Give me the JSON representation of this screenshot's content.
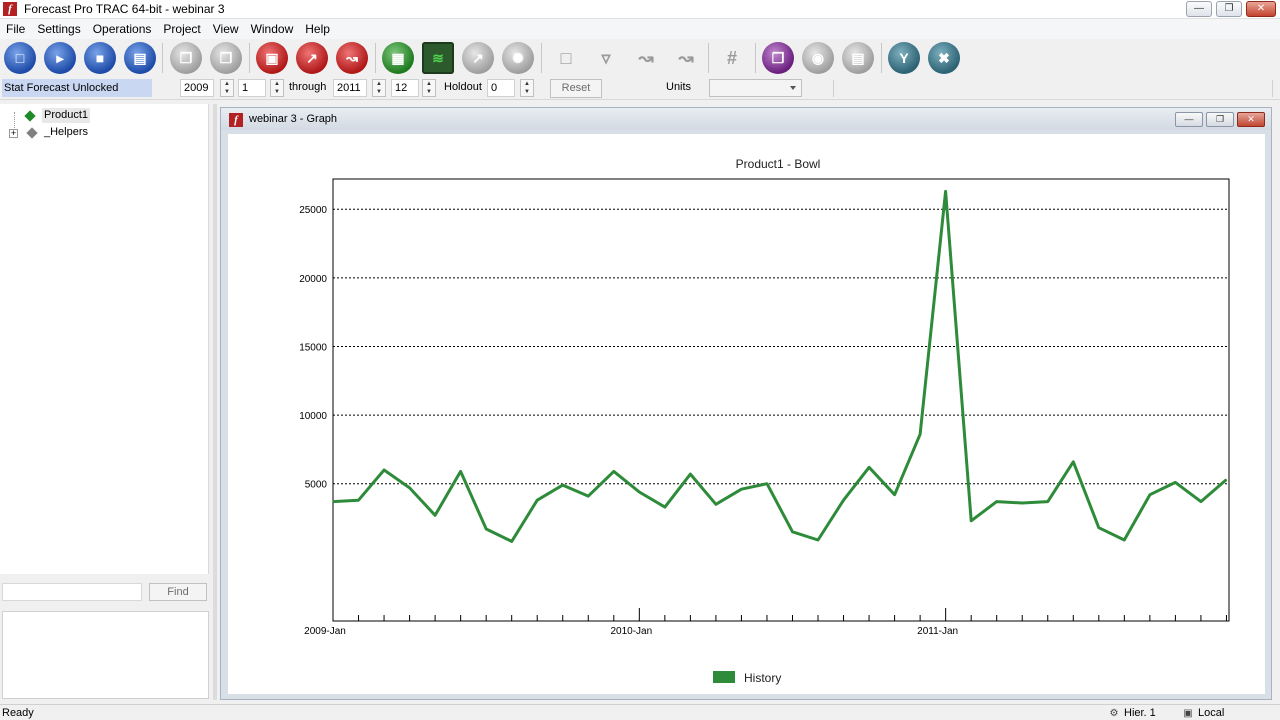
{
  "window": {
    "title": "Forecast Pro TRAC 64-bit - webinar 3",
    "logo_letter": "f"
  },
  "menu": [
    "File",
    "Settings",
    "Operations",
    "Project",
    "View",
    "Window",
    "Help"
  ],
  "toolbar": {
    "buttons": [
      {
        "icon": "new-icon"
      },
      {
        "icon": "open-icon"
      },
      {
        "icon": "save-icon"
      },
      {
        "icon": "print-icon"
      },
      {
        "icon": "copy-icon"
      },
      {
        "icon": "paste-icon"
      },
      {
        "icon": "film-icon"
      },
      {
        "icon": "forecast-icon"
      },
      {
        "icon": "trend-icon"
      },
      {
        "icon": "table-icon"
      },
      {
        "icon": "graph-icon"
      },
      {
        "icon": "line-icon"
      },
      {
        "icon": "paw-icon"
      },
      {
        "icon": "page-icon"
      },
      {
        "icon": "filter-icon"
      },
      {
        "icon": "edit-line-icon"
      },
      {
        "icon": "adjust-line-icon"
      },
      {
        "icon": "hash-icon"
      },
      {
        "icon": "export-icon"
      },
      {
        "icon": "globe-icon"
      },
      {
        "icon": "printer-icon"
      },
      {
        "icon": "funnel-icon"
      },
      {
        "icon": "tools-icon"
      }
    ]
  },
  "options": {
    "status": "Stat Forecast Unlocked",
    "start_year": "2009",
    "start_period": "1",
    "through_label": "through",
    "end_year": "2011",
    "end_period": "12",
    "holdout_label": "Holdout",
    "holdout": "0",
    "reset_label": "Reset",
    "units_label": "Units",
    "units_value": ""
  },
  "tree": {
    "items": [
      {
        "label": "Product1",
        "color": "#1f8a2a"
      },
      {
        "label": "_Helpers",
        "color": "#808080"
      }
    ]
  },
  "find": {
    "button_label": "Find",
    "input_value": ""
  },
  "graph_window": {
    "title": "webinar 3 - Graph"
  },
  "chart_data": {
    "type": "line",
    "title": "Product1 - Bowl",
    "xlabel": "",
    "ylabel": "",
    "x_tick_labels": [
      "2009-Jan",
      "2010-Jan",
      "2011-Jan"
    ],
    "y_tick_labels": [
      "5000",
      "10000",
      "15000",
      "20000",
      "25000"
    ],
    "y_ticks": [
      5000,
      10000,
      15000,
      20000,
      25000
    ],
    "ylim": [
      -5000,
      27200
    ],
    "grid": true,
    "grid_style": "dotted-horizontal",
    "legend_position": "bottom-center",
    "series": [
      {
        "name": "History",
        "color": "#2e8b3a",
        "x": [
          "2009-Jan",
          "2009-Feb",
          "2009-Mar",
          "2009-Apr",
          "2009-May",
          "2009-Jun",
          "2009-Jul",
          "2009-Aug",
          "2009-Sep",
          "2009-Oct",
          "2009-Nov",
          "2009-Dec",
          "2010-Jan",
          "2010-Feb",
          "2010-Mar",
          "2010-Apr",
          "2010-May",
          "2010-Jun",
          "2010-Jul",
          "2010-Aug",
          "2010-Sep",
          "2010-Oct",
          "2010-Nov",
          "2010-Dec",
          "2011-Jan",
          "2011-Feb",
          "2011-Mar",
          "2011-Apr",
          "2011-May",
          "2011-Jun",
          "2011-Jul",
          "2011-Aug",
          "2011-Sep",
          "2011-Oct",
          "2011-Nov",
          "2011-Dec"
        ],
        "values": [
          3700,
          3800,
          6000,
          4700,
          2700,
          5900,
          1700,
          800,
          3800,
          4900,
          4100,
          5900,
          4400,
          3300,
          5700,
          3500,
          4600,
          5000,
          1500,
          900,
          3800,
          6200,
          4200,
          8600,
          26300,
          2300,
          3700,
          3600,
          3700,
          6600,
          1800,
          900,
          4200,
          5100,
          3700,
          5300
        ]
      }
    ]
  },
  "status": {
    "text": "Ready",
    "hier": "Hier. 1",
    "location": "Local"
  }
}
